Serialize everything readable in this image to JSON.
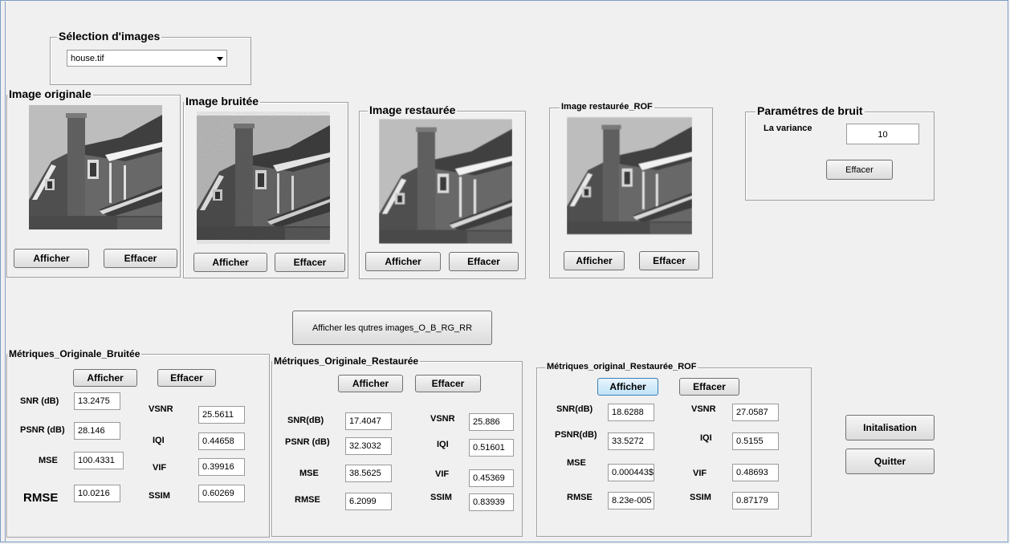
{
  "selection": {
    "title": "Sélection d'images",
    "selected": "house.tif"
  },
  "panels": {
    "original": {
      "title": "Image originale",
      "show": "Afficher",
      "clear": "Effacer"
    },
    "noisy": {
      "title": "Image bruitée",
      "show": "Afficher",
      "clear": "Effacer"
    },
    "restored": {
      "title": "Image restaurée",
      "show": "Afficher",
      "clear": "Effacer"
    },
    "restored_rof": {
      "title": "Image restaurée_ROF",
      "show": "Afficher",
      "clear": "Effacer"
    }
  },
  "noise": {
    "title": "Paramétres de bruit",
    "variance_label": "La variance",
    "variance_value": "10",
    "clear": "Effacer"
  },
  "show_all_button": "Afficher les qutres images_O_B_RG_RR",
  "metrics_ob": {
    "title": "Métriques_Originale_Bruitée",
    "show": "Afficher",
    "clear": "Effacer",
    "labels": {
      "snr": "SNR (dB)",
      "psnr": "PSNR (dB)",
      "mse": "MSE",
      "rmse": "RMSE",
      "vsnr": "VSNR",
      "iqi": "IQI",
      "vif": "VIF",
      "ssim": "SSIM"
    },
    "values": {
      "snr": "13.2475",
      "psnr": "28.146",
      "mse": "100.4331",
      "rmse": "10.0216",
      "vsnr": "25.5611",
      "iqi": "0.44658",
      "vif": "0.39916",
      "ssim": "0.60269"
    }
  },
  "metrics_or": {
    "title": "Métriques_Originale_Restaurée",
    "show": "Afficher",
    "clear": "Effacer",
    "labels": {
      "snr": "SNR(dB)",
      "psnr": "PSNR (dB)",
      "mse": "MSE",
      "rmse": "RMSE",
      "vsnr": "VSNR",
      "iqi": "IQI",
      "vif": "VIF",
      "ssim": "SSIM"
    },
    "values": {
      "snr": "17.4047",
      "psnr": "32.3032",
      "mse": "38.5625",
      "rmse": "6.2099",
      "vsnr": "25.886",
      "iqi": "0.51601",
      "vif": "0.45369",
      "ssim": "0.83939"
    }
  },
  "metrics_rof": {
    "title": "Métriques_original_Restaurée_ROF",
    "show": "Afficher",
    "clear": "Effacer",
    "labels": {
      "snr": "SNR(dB)",
      "psnr": "PSNR(dB)",
      "mse": "MSE",
      "rmse": "RMSE",
      "vsnr": "VSNR",
      "iqi": "IQI",
      "vif": "VIF",
      "ssim": "SSIM"
    },
    "values": {
      "snr": "18.6288",
      "psnr": "33.5272",
      "mse": "0.000443$",
      "rmse": "8.23e-005",
      "vsnr": "27.0587",
      "iqi": "0.5155",
      "vif": "0.48693",
      "ssim": "0.87179"
    }
  },
  "actions": {
    "init": "Initalisation",
    "quit": "Quitter"
  }
}
